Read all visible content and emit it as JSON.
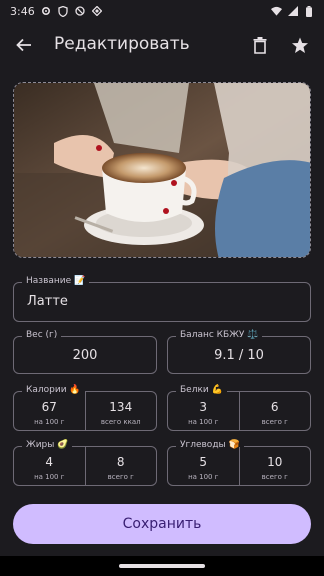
{
  "status": {
    "time": "3:46",
    "left_icons": [
      "gear-icon",
      "shield-icon",
      "blocked-icon",
      "diamond-icon"
    ],
    "right_icons": [
      "wifi-icon",
      "signal-icon",
      "battery-icon"
    ]
  },
  "app_bar": {
    "title": "Редактировать",
    "icons": [
      "arrow-back-icon",
      "delete-icon",
      "star-icon"
    ]
  },
  "photo": {
    "description_icon": "latte-photo"
  },
  "form": {
    "name": {
      "label": "Название 📝",
      "value": "Латте"
    },
    "weight": {
      "label": "Вес (г)",
      "value": "200"
    },
    "balance": {
      "label": "Баланс КБЖУ ⚖️",
      "value": "9.1 / 10"
    },
    "calories": {
      "label": "Калории 🔥",
      "per100": "67",
      "per100_label": "на 100 г",
      "total": "134",
      "total_label": "всего ккал"
    },
    "protein": {
      "label": "Белки 💪",
      "per100": "3",
      "per100_label": "на 100 г",
      "total": "6",
      "total_label": "всего г"
    },
    "fat": {
      "label": "Жиры 🥑",
      "per100": "4",
      "per100_label": "на 100 г",
      "total": "8",
      "total_label": "всего г"
    },
    "carbs": {
      "label": "Углеводы 🍞",
      "per100": "5",
      "per100_label": "на 100 г",
      "total": "10",
      "total_label": "всего г"
    }
  },
  "actions": {
    "save_label": "Сохранить"
  },
  "colors": {
    "background": "#1c1b1f",
    "accent": "#d0bcff",
    "on_accent": "#381e72",
    "outline": "#6e6a75"
  }
}
